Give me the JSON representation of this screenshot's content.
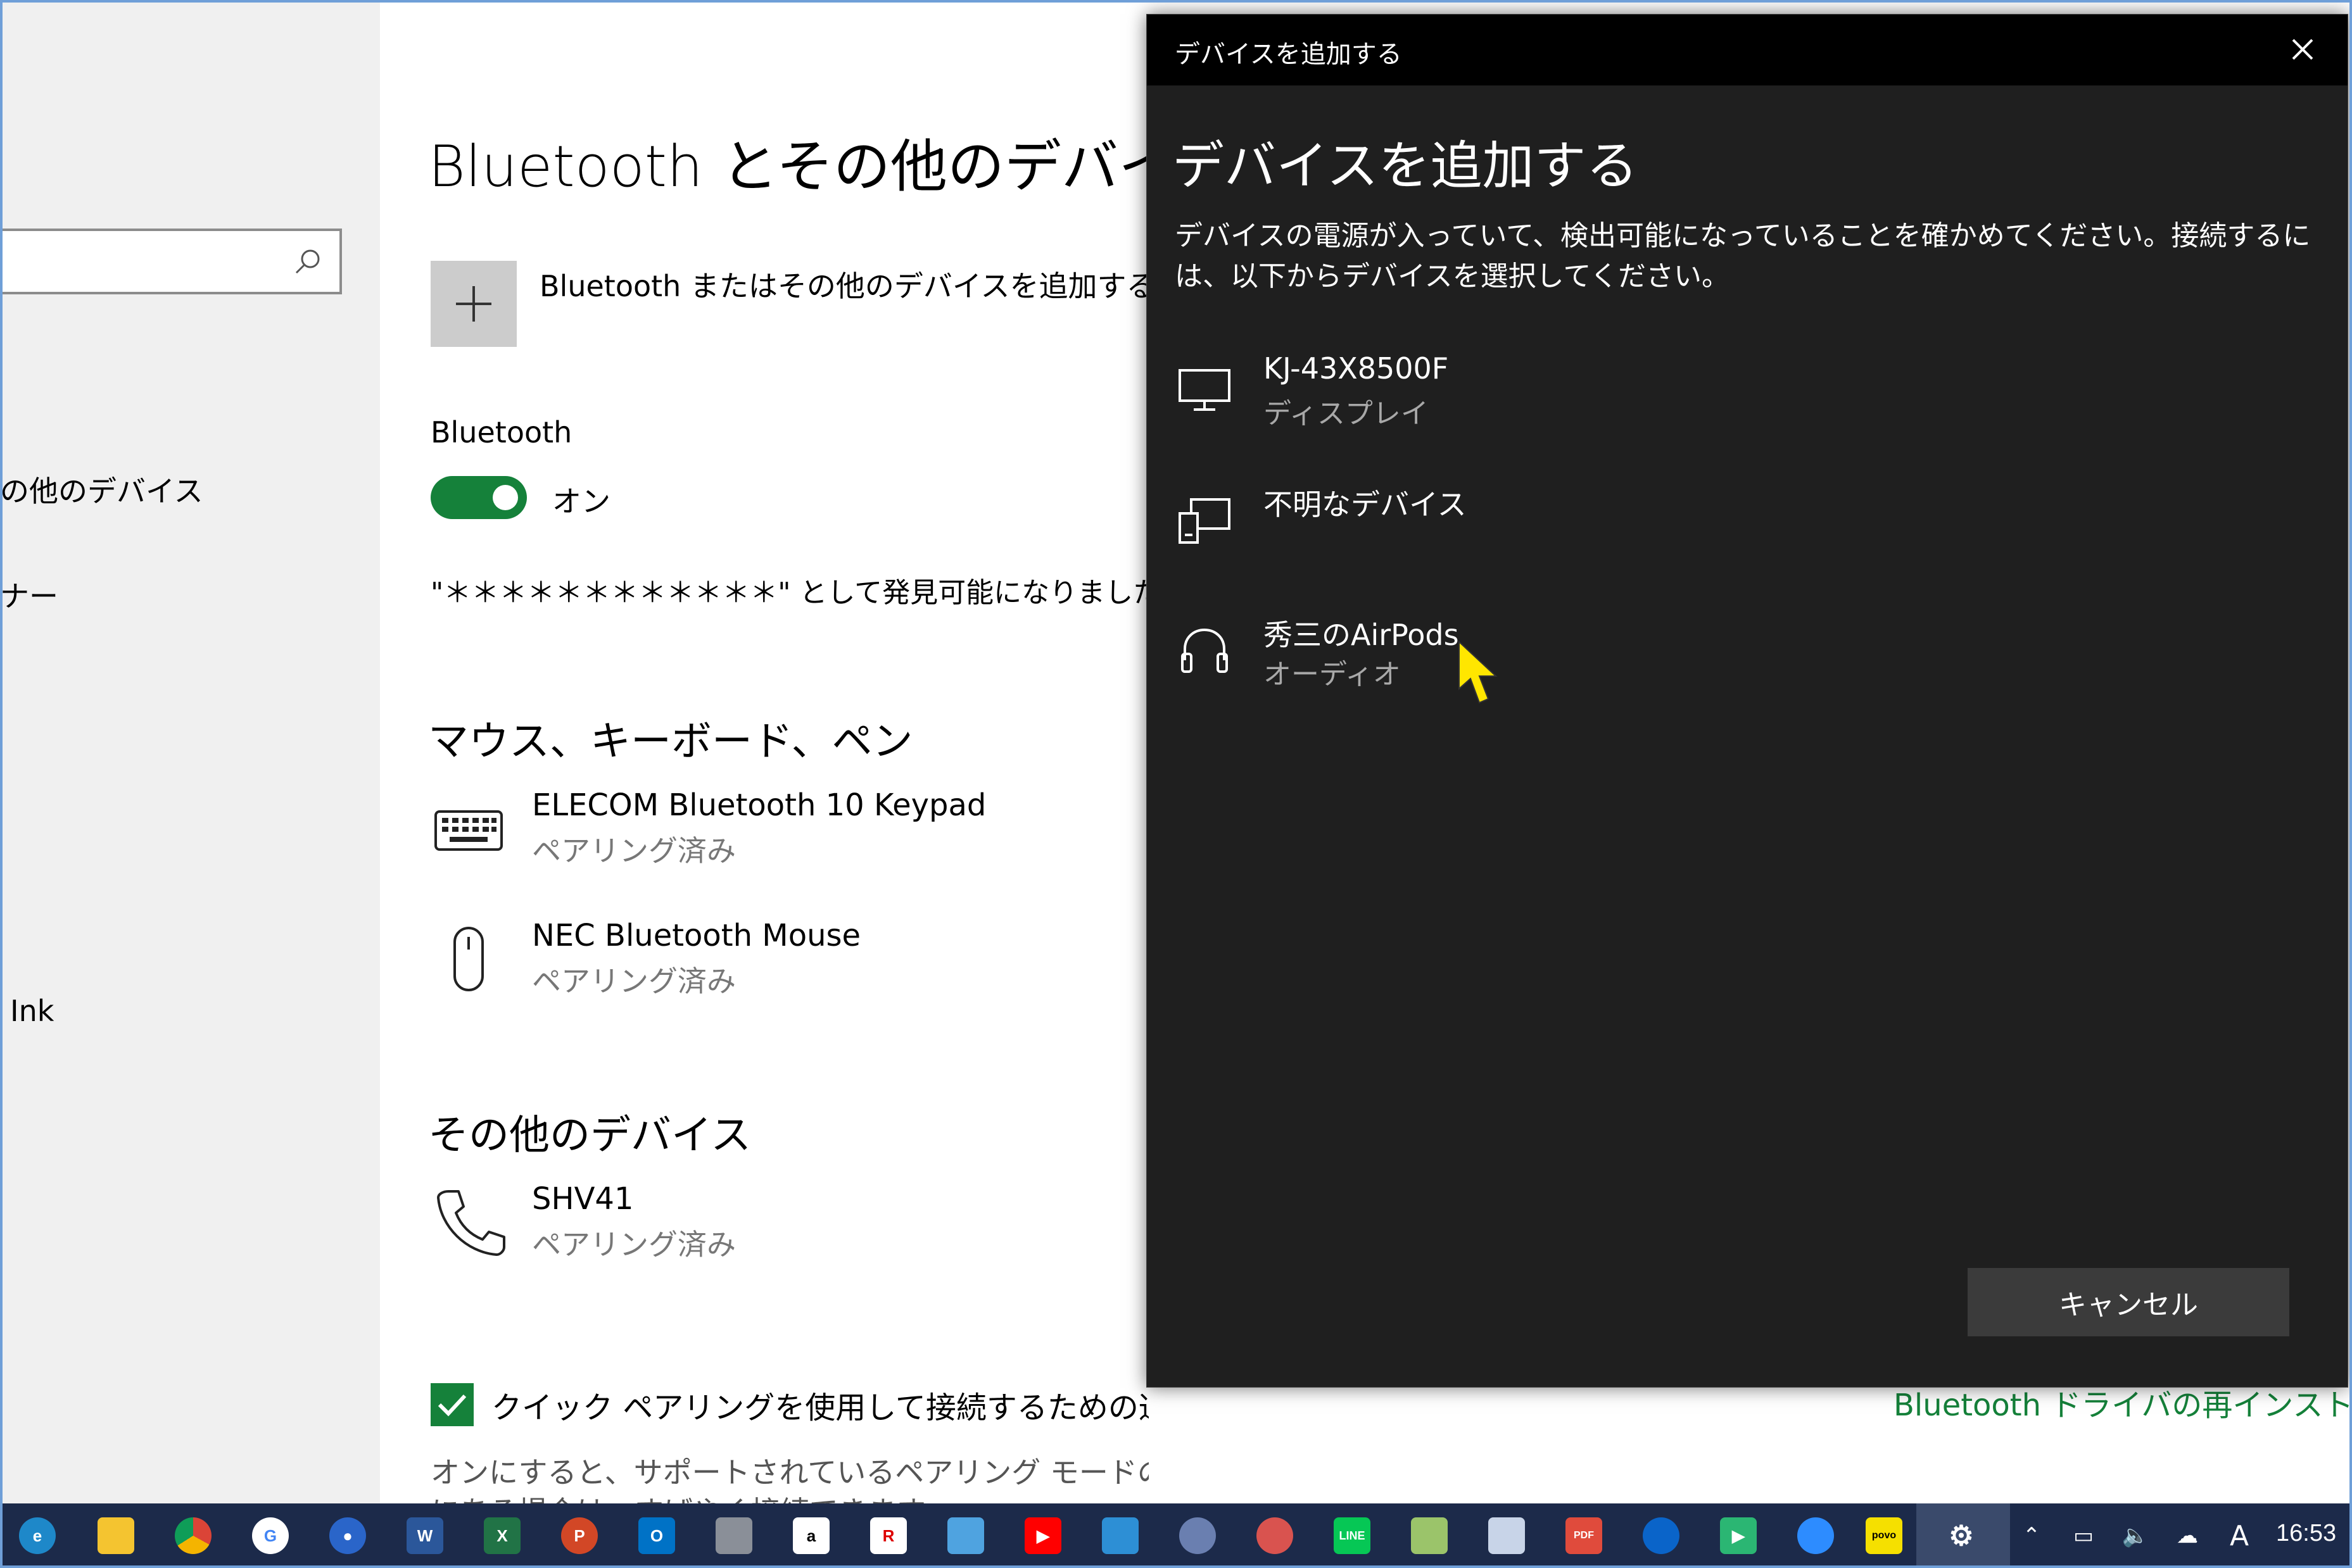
{
  "left_nav": {
    "items": [
      {
        "label": "の他のデバイス"
      },
      {
        "label": "ナー"
      },
      {
        "label": "Ink"
      }
    ]
  },
  "main": {
    "title": "Bluetooth とその他のデバイス",
    "add_label": "Bluetooth またはその他のデバイスを追加する",
    "bluetooth_label": "Bluetooth",
    "toggle_state": "オン",
    "discover_text": "\"＊＊＊＊＊＊＊＊＊＊＊＊\" として発見可能になりました",
    "section_input": "マウス、キーボード、ペン",
    "input_devices": [
      {
        "name": "ELECOM Bluetooth 10 Keypad",
        "status": "ペアリング済み",
        "icon": "keyboard-icon"
      },
      {
        "name": "NEC Bluetooth Mouse",
        "status": "ペアリング済み",
        "icon": "mouse-icon"
      }
    ],
    "section_other": "その他のデバイス",
    "other_devices": [
      {
        "name": "SHV41",
        "status": "ペアリング済み",
        "icon": "phone-icon"
      }
    ],
    "quick_pair_label": "クイック ペアリングを使用して接続するための通知を表示する",
    "quick_pair_desc": "オンにすると、サポートされているペアリング モードの Bluetooth デバイスが近く",
    "quick_pair_desc2": "にある場合は、すばやく接続できます。",
    "reinstall_link": "Bluetooth ドライバの再インストール"
  },
  "dialog": {
    "titlebar": "デバイスを追加する",
    "heading": "デバイスを追加する",
    "description": "デバイスの電源が入っていて、検出可能になっていることを確かめてください。接続するには、以下からデバイスを選択してください。",
    "devices": [
      {
        "name": "KJ-43X8500F",
        "type": "ディスプレイ",
        "icon": "monitor-icon"
      },
      {
        "name": "不明なデバイス",
        "type": "",
        "icon": "unknown-device-icon"
      },
      {
        "name": "秀三のAirPods",
        "type": "オーディオ",
        "icon": "headphones-icon"
      }
    ],
    "cancel_label": "キャンセル"
  },
  "taskbar": {
    "clock": "16:53",
    "ime": "A",
    "apps": [
      "edge",
      "explorer",
      "chrome",
      "google",
      "people",
      "word",
      "excel",
      "powerpoint",
      "outlook",
      "app",
      "amazon",
      "iris",
      "app",
      "youtube",
      "photos",
      "paint",
      "app",
      "line",
      "app",
      "app",
      "pdf-png",
      "onedrive",
      "play",
      "zoom",
      "povo",
      "settings"
    ]
  },
  "colors": {
    "accent": "#15813a",
    "dialog_bg": "#1f1f1f",
    "taskbar_bg": "#1c2a4a"
  }
}
